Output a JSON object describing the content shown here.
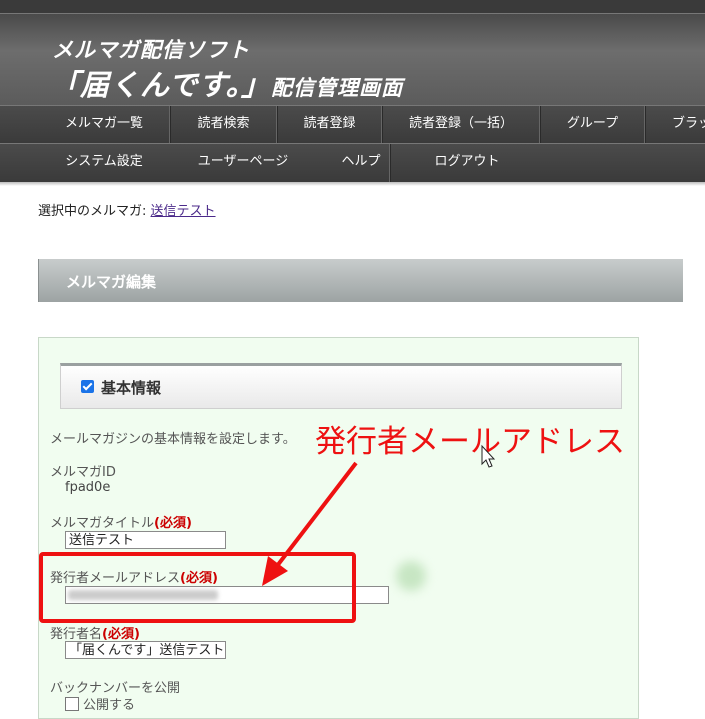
{
  "header": {
    "title_line1": "メルマガ配信ソフト",
    "title_main": "「届くんです。」",
    "title_sub": "配信管理画面"
  },
  "nav_row1": [
    "メルマガ一覧",
    "読者検索",
    "読者登録",
    "読者登録（一括）",
    "グループ",
    "ブラッ"
  ],
  "nav_row2": [
    "システム設定",
    "ユーザーページ",
    "ヘルプ",
    "ログアウト"
  ],
  "selected": {
    "label": "選択中のメルマガ: ",
    "link": "送信テスト"
  },
  "section": {
    "title": "メルマガ編集"
  },
  "basic_info": {
    "group_title": "基本情報",
    "description": "メールマガジンの基本情報を設定します。",
    "id_label": "メルマガID",
    "id_value": "fpad0e",
    "title_label": "メルマガタイトル",
    "title_value": "送信テスト",
    "sender_email_label": "発行者メールアドレス",
    "sender_name_label": "発行者名",
    "sender_name_value": "「届くんです」送信テスト",
    "backnumber_label": "バックナンバーを公開",
    "publish_checkbox_label": "公開する",
    "required_mark": "(必須)"
  },
  "annotation": {
    "text": "発行者メールアドレス",
    "color": "#ee1111"
  },
  "colors": {
    "header_bg": "#5b5b5b",
    "nav_bg": "#3a3a3a",
    "panel_bg": "#f1fdf0",
    "required": "#cc0000"
  }
}
